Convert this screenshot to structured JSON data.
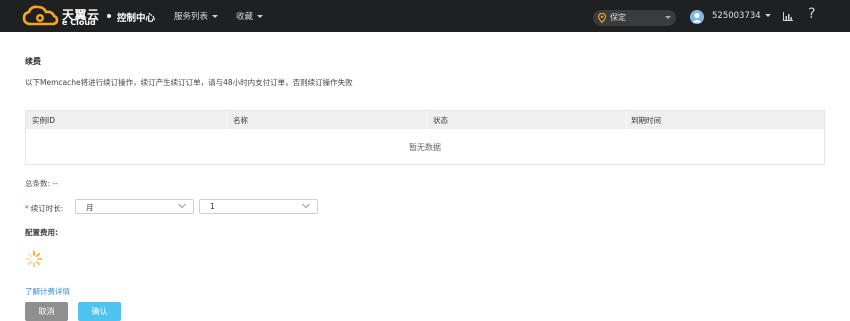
{
  "header": {
    "logo_cn": "天翼云",
    "logo_en": "e Cloud",
    "console_label": "控制中心",
    "nav": [
      {
        "label": "服务列表"
      },
      {
        "label": "收藏"
      }
    ],
    "region": "保定",
    "username": "525003734",
    "help_label": "?"
  },
  "page": {
    "title": "续费",
    "notice": "以下Memcache将进行续订操作，续订产生续订订单，请与48小时内支付订单，否则续订操作失败"
  },
  "table": {
    "columns": [
      "实例ID",
      "名称",
      "状态",
      "到期时间"
    ],
    "empty_text": "暂无数据"
  },
  "form": {
    "total_label": "总条数: --",
    "required_mark": "*",
    "duration_label": "续订时长:",
    "unit_value": "月",
    "count_value": "1",
    "fee_label": "配置费用:",
    "pricing_link": "了解计费详情"
  },
  "buttons": {
    "cancel": "取消",
    "confirm": "确认"
  },
  "colors": {
    "topbar": "#1f2022",
    "link": "#2d8fd5",
    "confirm": "#4fc3f0",
    "cancel": "#8f8f8f",
    "spinner": "#f5a623"
  }
}
